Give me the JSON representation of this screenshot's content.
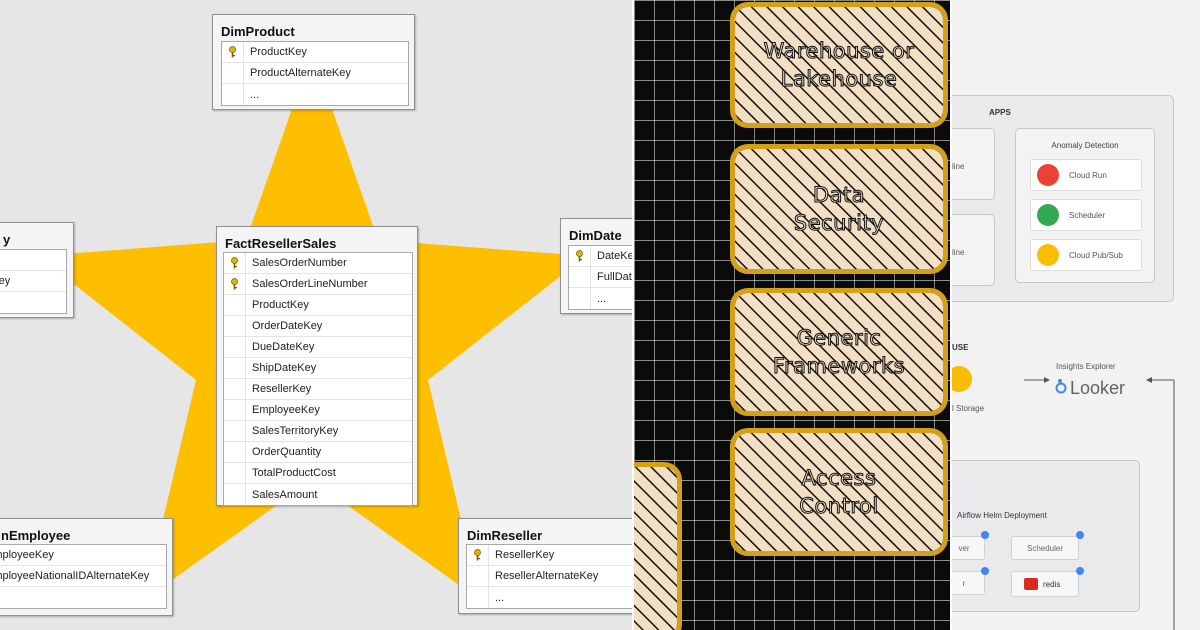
{
  "star_schema": {
    "fact": {
      "name": "FactResellerSales",
      "rows": [
        {
          "label": "SalesOrderNumber",
          "key": true
        },
        {
          "label": "SalesOrderLineNumber",
          "key": true
        },
        {
          "label": "ProductKey",
          "key": false
        },
        {
          "label": "OrderDateKey",
          "key": false
        },
        {
          "label": "DueDateKey",
          "key": false
        },
        {
          "label": "ShipDateKey",
          "key": false
        },
        {
          "label": "ResellerKey",
          "key": false
        },
        {
          "label": "EmployeeKey",
          "key": false
        },
        {
          "label": "SalesTerritoryKey",
          "key": false
        },
        {
          "label": "OrderQuantity",
          "key": false
        },
        {
          "label": "TotalProductCost",
          "key": false
        },
        {
          "label": "SalesAmount",
          "key": false
        }
      ]
    },
    "product": {
      "name": "DimProduct",
      "rows": [
        {
          "label": "ProductKey",
          "key": true
        },
        {
          "label": "ProductAlternateKey",
          "key": false
        },
        {
          "label": "...",
          "key": false
        }
      ]
    },
    "left": {
      "name": "y",
      "rows": [
        {
          "label": "",
          "key": false
        },
        {
          "label": "ateKey",
          "key": false
        },
        {
          "label": "",
          "key": false
        }
      ]
    },
    "date": {
      "name": "DimDate",
      "rows": [
        {
          "label": "DateKey",
          "key": true
        },
        {
          "label": "FullDate",
          "key": false
        },
        {
          "label": "...",
          "key": false
        }
      ]
    },
    "employee": {
      "name": "nEmployee",
      "rows": [
        {
          "label": "EmployeeKey",
          "key": false
        },
        {
          "label": "EmployeeNationalIDAlternateKey",
          "key": false
        },
        {
          "label": "...",
          "key": false
        }
      ]
    },
    "reseller": {
      "name": "DimReseller",
      "rows": [
        {
          "label": "ResellerKey",
          "key": true
        },
        {
          "label": "ResellerAlternateKey",
          "key": false
        },
        {
          "label": "...",
          "key": false
        }
      ]
    },
    "colors": {
      "star": "#fdbf00",
      "key_icon": "#e2b400"
    }
  },
  "sketch": {
    "boxes": [
      {
        "label": "Warehouse or Lakehouse"
      },
      {
        "label": "Data Security"
      },
      {
        "label": "Generic Frameworks"
      },
      {
        "label": "Access Control"
      }
    ],
    "colors": {
      "border": "#d4a017",
      "fill": "#f3dfc3",
      "grid": "#e8e8e8"
    }
  },
  "gcp": {
    "apps_title": "APPS",
    "left_partial": [
      "line",
      "line"
    ],
    "anomaly": {
      "title": "Anomaly Detection",
      "services": [
        {
          "name": "Cloud Run",
          "icon": "cloud-run-icon",
          "color": "#ea4335"
        },
        {
          "name": "Scheduler",
          "icon": "scheduler-icon",
          "color": "#34a853"
        },
        {
          "name": "Cloud Pub/Sub",
          "icon": "pubsub-icon",
          "color": "#fbbc04"
        }
      ]
    },
    "house_partial": "USE",
    "storage_partial": "l Storage",
    "insights_label": "Insights Explorer",
    "looker_label": "Looker",
    "airflow_title": "Airflow Helm Deployment",
    "airflow_left_partial": [
      "ver",
      "r"
    ],
    "scheduler_label": "Scheduler",
    "redis_label": "redis"
  }
}
